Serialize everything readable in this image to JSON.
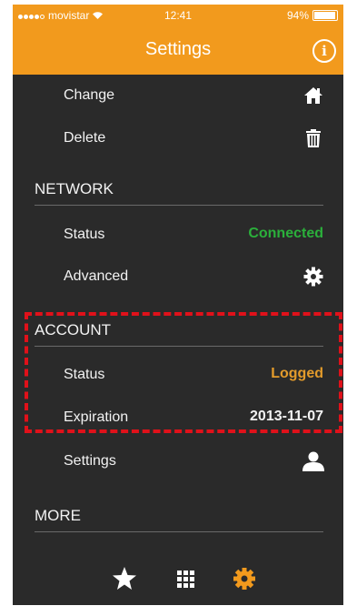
{
  "status_bar": {
    "carrier": "movistar",
    "time": "12:41",
    "battery": "94%",
    "battery_level": 0.94
  },
  "header": {
    "title": "Settings",
    "info_icon": "info-icon"
  },
  "rows_top": [
    {
      "label": "Change",
      "icon": "home-icon"
    },
    {
      "label": "Delete",
      "icon": "trash-icon"
    }
  ],
  "network": {
    "heading": "NETWORK",
    "status_label": "Status",
    "status_value": "Connected",
    "advanced_label": "Advanced",
    "advanced_icon": "gear-icon"
  },
  "account": {
    "heading": "ACCOUNT",
    "status_label": "Status",
    "status_value": "Logged",
    "expiration_label": "Expiration",
    "expiration_value": "2013-11-07",
    "settings_label": "Settings",
    "settings_icon": "user-icon"
  },
  "more": {
    "heading": "MORE"
  },
  "tabs": [
    {
      "icon": "star-icon",
      "active": false
    },
    {
      "icon": "grid-icon",
      "active": false
    },
    {
      "icon": "gear-icon",
      "active": true
    }
  ],
  "colors": {
    "accent": "#f29a1d",
    "connected": "#2bb03b",
    "logged": "#e39b2b",
    "highlight": "#e0111a",
    "background": "#2a2a2a"
  }
}
